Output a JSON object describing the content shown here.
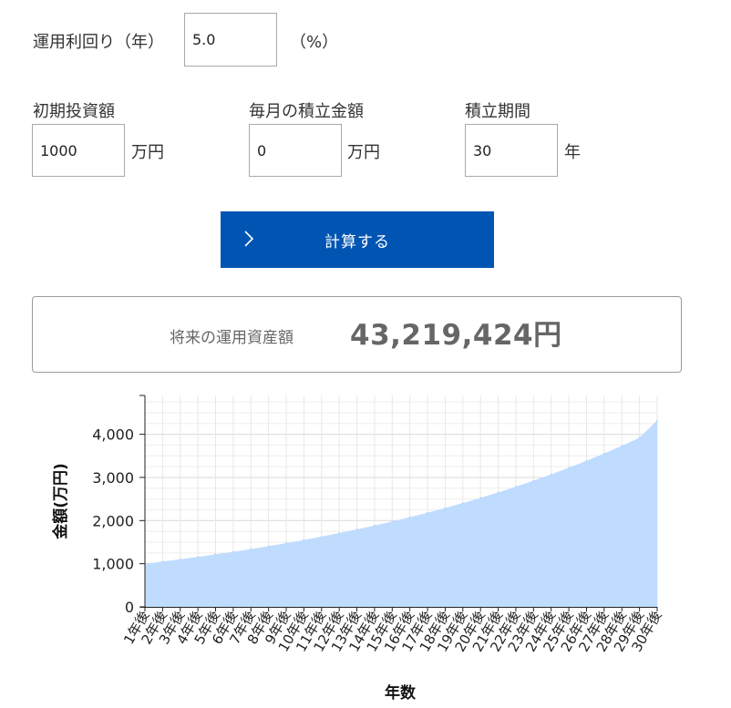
{
  "form": {
    "rate_label": "運用利回り（年）",
    "rate_value": "5.0",
    "rate_unit": "（%）",
    "initial_label": "初期投資額",
    "initial_value": "1000",
    "initial_unit": "万円",
    "monthly_label": "毎月の積立金額",
    "monthly_value": "0",
    "monthly_unit": "万円",
    "period_label": "積立期間",
    "period_value": "30",
    "period_unit": "年",
    "calc_button": "計算する"
  },
  "result": {
    "label": "将来の運用資産額",
    "value": "43,219,424円"
  },
  "colors": {
    "button": "#0055b3",
    "area_fill": "#bfdcff"
  },
  "icons": {
    "button_icon": "chevron-right-icon"
  },
  "chart_data": {
    "type": "area",
    "xlabel": "年数",
    "ylabel": "金額(万円)",
    "ylim": [
      0,
      4900
    ],
    "yticks": [
      0,
      1000,
      2000,
      3000,
      4000
    ],
    "ytick_labels": [
      "0",
      "1,000",
      "2,000",
      "3,000",
      "4,000"
    ],
    "grid": true,
    "categories": [
      "1年後",
      "2年後",
      "3年後",
      "4年後",
      "5年後",
      "6年後",
      "7年後",
      "8年後",
      "9年後",
      "10年後",
      "11年後",
      "12年後",
      "13年後",
      "14年後",
      "15年後",
      "16年後",
      "17年後",
      "18年後",
      "19年後",
      "20年後",
      "21年後",
      "22年後",
      "23年後",
      "24年後",
      "25年後",
      "26年後",
      "27年後",
      "28年後",
      "29年後",
      "30年後"
    ],
    "series": [
      {
        "values": [
          1000,
          1050,
          1103,
          1158,
          1216,
          1276,
          1340,
          1407,
          1477,
          1551,
          1629,
          1710,
          1796,
          1886,
          1980,
          2079,
          2183,
          2292,
          2407,
          2527,
          2653,
          2786,
          2925,
          3072,
          3225,
          3386,
          3556,
          3733,
          3920,
          4322
        ]
      }
    ]
  }
}
